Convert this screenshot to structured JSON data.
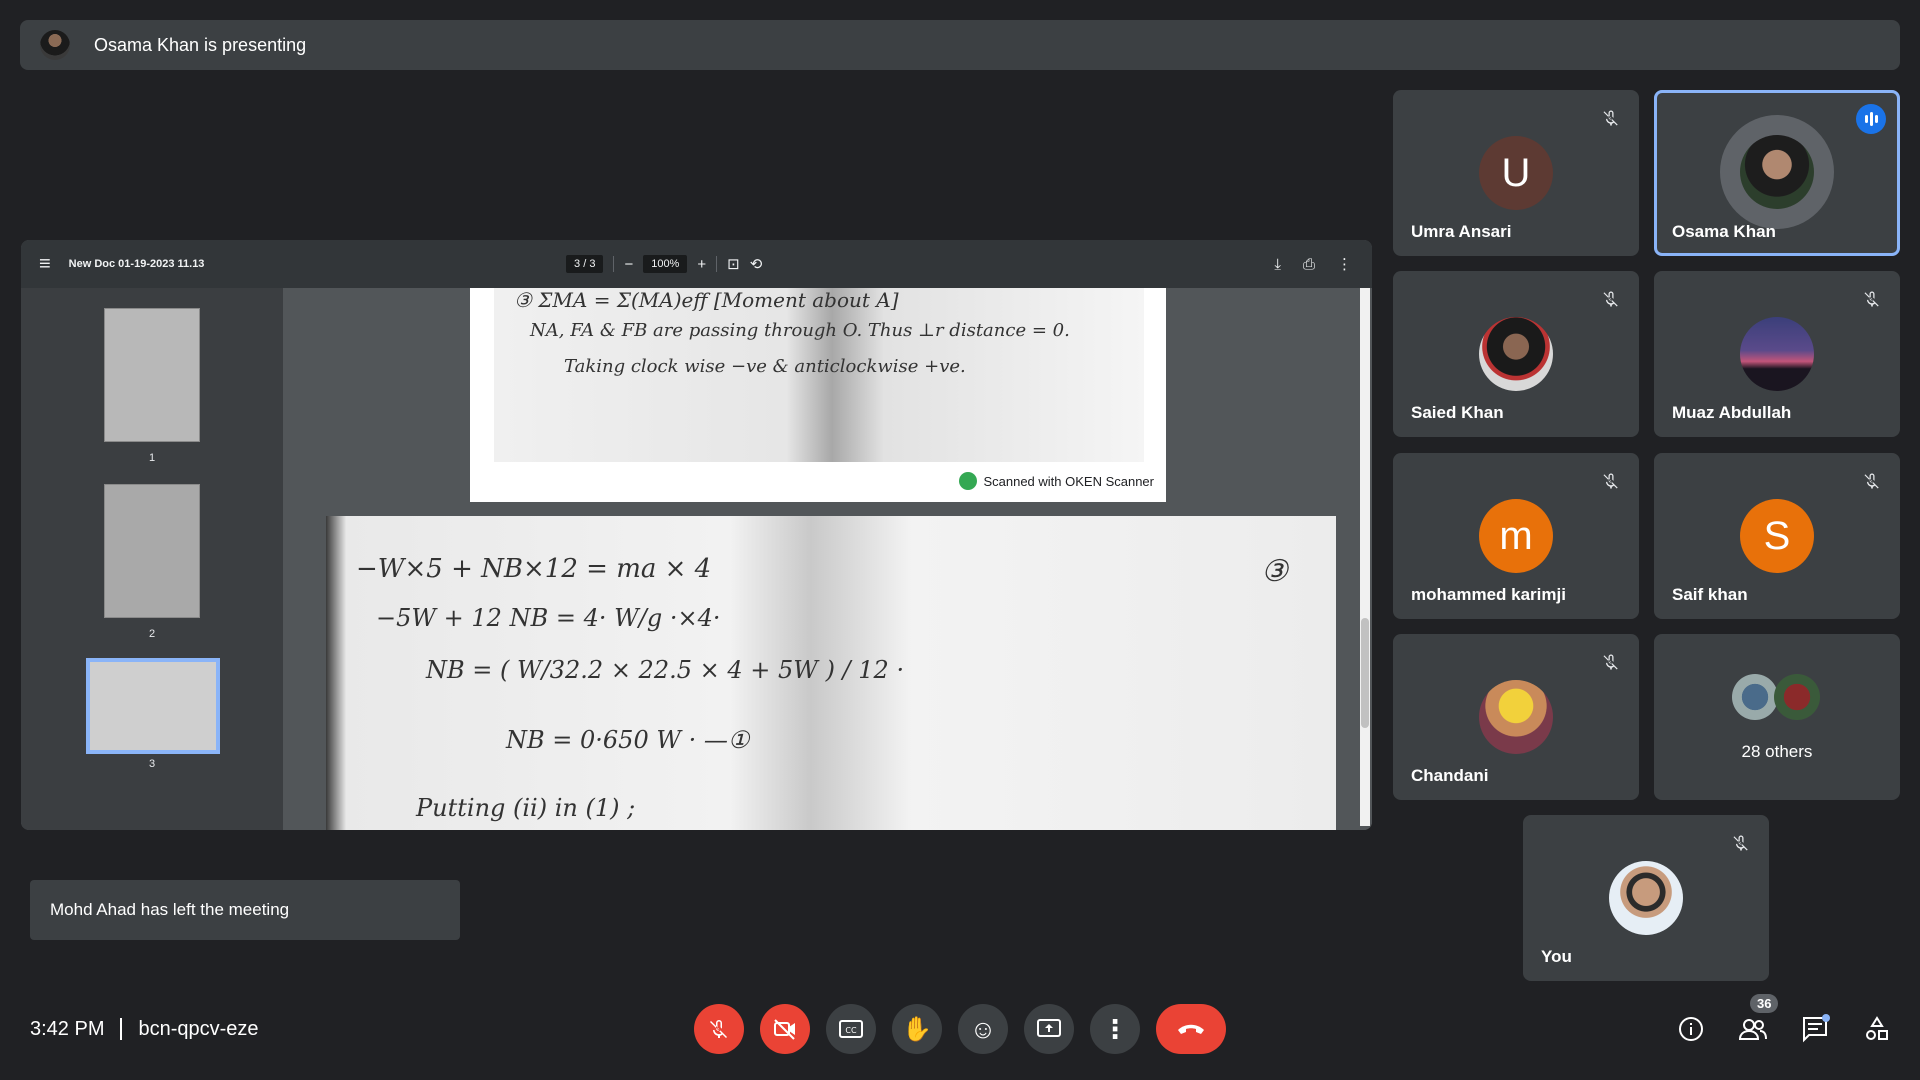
{
  "presenting": {
    "text": "Osama Khan is presenting"
  },
  "viewer": {
    "doc_title": "New Doc 01-19-2023 11.13",
    "page_current": "3",
    "page_separator": "/",
    "page_total": "3",
    "zoom": "100%",
    "thumbnails": [
      {
        "num": "1"
      },
      {
        "num": "2"
      },
      {
        "num": "3"
      }
    ],
    "page1_lines": [
      "③ ΣMA = Σ(MA)eff   [Moment about A]",
      "NA, FA & FB are passing through O. Thus ⊥r distance = 0.",
      "Taking clock wise −ve & anticlockwise +ve."
    ],
    "scanner_text": "Scanned with OKEN Scanner",
    "page2_lines": [
      "−W×5 + NB×12 = ma × 4",
      "−5W + 12 NB = 4·  W/g ·×4·",
      "NB = ( W/32.2 × 22.5 × 4 + 5W ) / 12 ·",
      "NB = 0·650 W · —①",
      "Putting (ii) in (1) ;"
    ],
    "page2_number": "③"
  },
  "participants": [
    {
      "name": "Umra Ansari",
      "initial": "U",
      "color": "#5d3a33",
      "muted": true,
      "type": "letter"
    },
    {
      "name": "Osama Khan",
      "initial": "",
      "color": "#2b2b2b",
      "muted": false,
      "type": "photo",
      "active": true
    },
    {
      "name": "Saied Khan",
      "initial": "",
      "color": "#444",
      "muted": true,
      "type": "photo"
    },
    {
      "name": "Muaz Abdullah",
      "initial": "",
      "color": "#3a3550",
      "muted": true,
      "type": "photo"
    },
    {
      "name": "mohammed karimji",
      "initial": "m",
      "color": "#e8710a",
      "muted": true,
      "type": "letter"
    },
    {
      "name": "Saif khan",
      "initial": "S",
      "color": "#e8710a",
      "muted": true,
      "type": "letter"
    },
    {
      "name": "Chandani",
      "initial": "",
      "color": "#a54a6b",
      "muted": true,
      "type": "photo"
    },
    {
      "name": "You",
      "initial": "",
      "color": "#d8e4ef",
      "muted": true,
      "type": "photo"
    }
  ],
  "others": {
    "label": "28 others"
  },
  "toast": {
    "text": "Mohd Ahad has left the meeting"
  },
  "meeting": {
    "time": "3:42 PM",
    "code": "bcn-qpcv-eze"
  },
  "people_count": "36",
  "colors": {
    "background": "#202124",
    "tile": "#3c4043",
    "red": "#ea4335",
    "accent": "#8ab4f8"
  }
}
